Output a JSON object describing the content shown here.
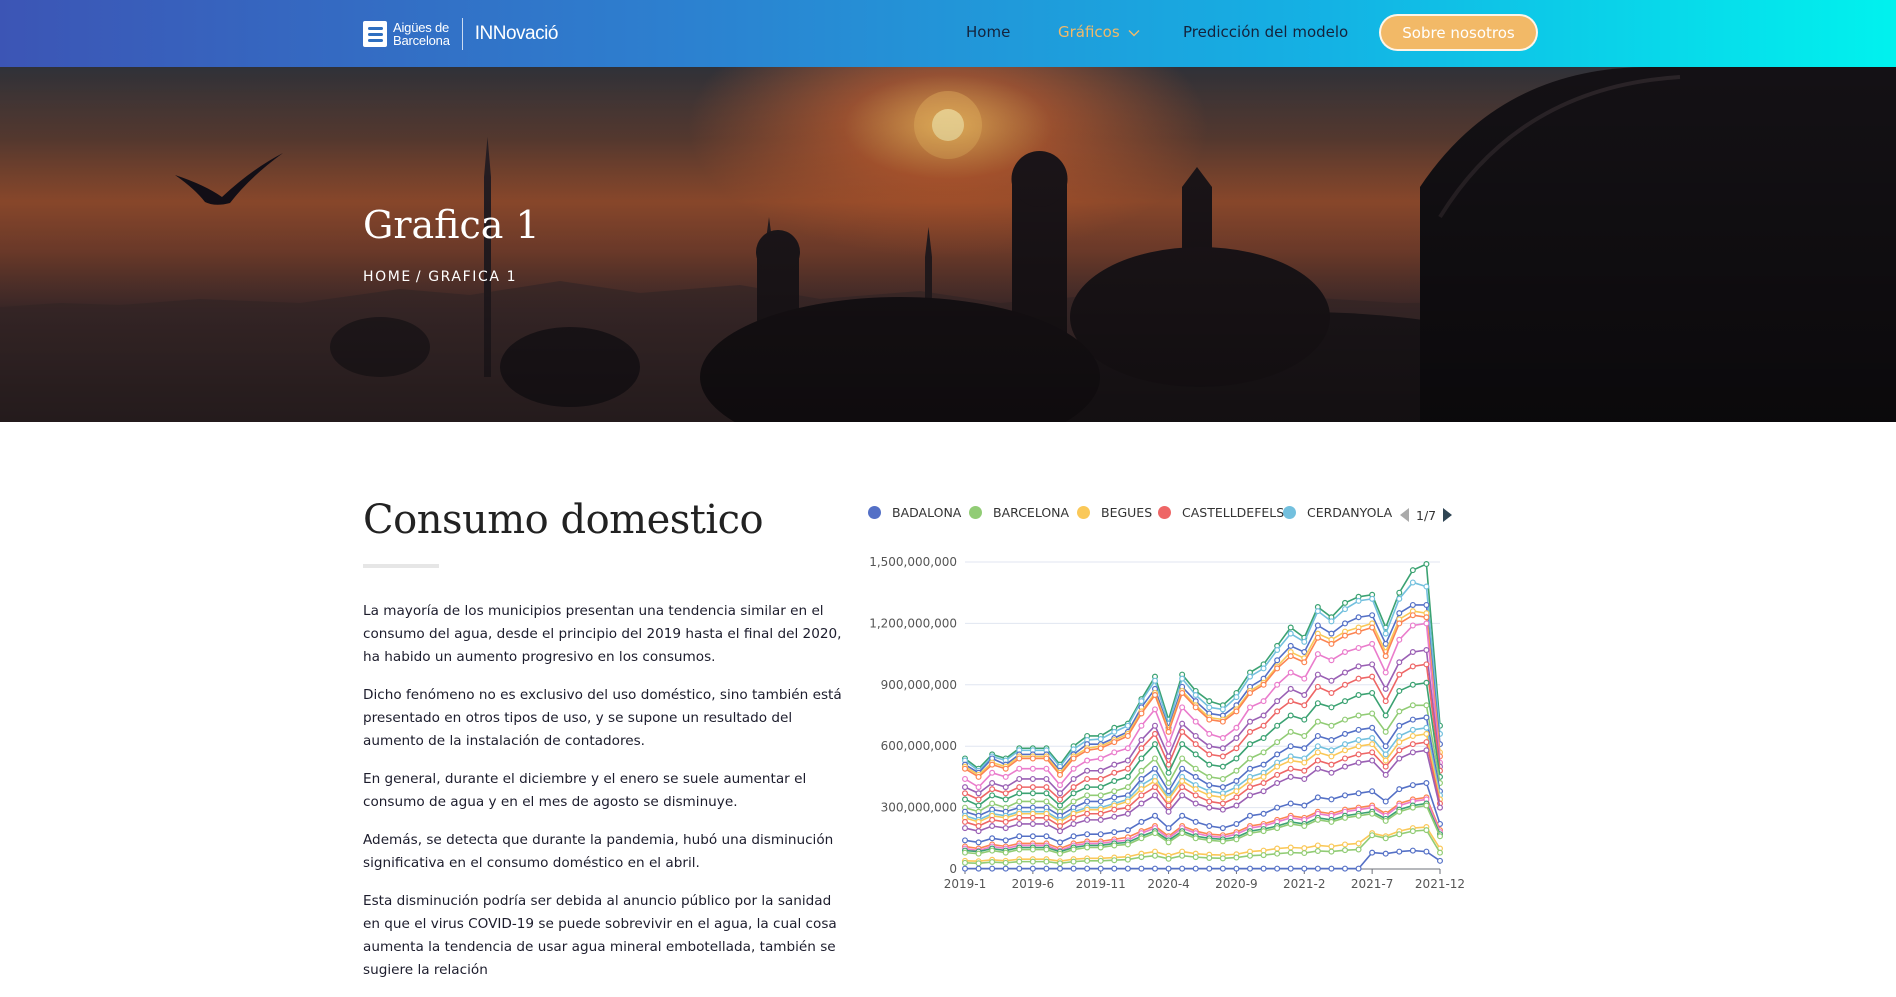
{
  "header": {
    "logo_line1": "Aigües de",
    "logo_line2": "Barcelona",
    "logo_sub": "INNovació",
    "nav": [
      {
        "label": "Home",
        "active": false
      },
      {
        "label": "Gráficos",
        "active": true
      },
      {
        "label": "Predicción del modelo",
        "active": false
      }
    ],
    "cta_label": "Sobre nosotros",
    "colors": {
      "gradient_start": "#3c55b5",
      "gradient_end": "#00f2ee",
      "accent": "#f2b967"
    }
  },
  "hero": {
    "title": "Grafica 1",
    "breadcrumb_home": "HOME",
    "breadcrumb_sep": "/",
    "breadcrumb_current": "GRAFICA 1"
  },
  "content": {
    "section_title": "Consumo domestico",
    "paragraphs": [
      "La mayoría de los municipios presentan una tendencia similar en el consumo del agua, desde el principio del 2019 hasta el final del 2020, ha habido un aumento progresivo en los consumos.",
      "Dicho fenómeno no es exclusivo del uso doméstico, sino también está presentado en otros tipos de uso, y se supone un resultado del aumento de la instalación de contadores.",
      "En general, durante el diciembre y el enero se suele aumentar el consumo de agua y en el mes de agosto se disminuye.",
      "Además, se detecta que durante la pandemia, hubó una disminución significativa en el consumo doméstico en el abril.",
      "Esta disminución podría ser debida al anuncio público por la sanidad en que el virus COVID-19 se puede sobrevivir en el agua, la cual cosa aumenta la tendencia de usar agua mineral embotellada, también se sugiere la relación"
    ]
  },
  "chart_data": {
    "type": "line",
    "legend": {
      "position": "top",
      "visible_entries": [
        {
          "name": "BADALONA",
          "color": "#5470c6"
        },
        {
          "name": "BARCELONA",
          "color": "#91cc75"
        },
        {
          "name": "BEGUES",
          "color": "#fac858"
        },
        {
          "name": "CASTELLDEFELS",
          "color": "#ee6666"
        },
        {
          "name": "CERDANYOLA",
          "color": "#73c0de"
        }
      ],
      "page": "1/7"
    },
    "x_tick_labels": [
      "2019-1",
      "2019-6",
      "2019-11",
      "2020-4",
      "2020-9",
      "2021-2",
      "2021-7",
      "2021-12"
    ],
    "x": [
      "2019-1",
      "2019-2",
      "2019-3",
      "2019-4",
      "2019-5",
      "2019-6",
      "2019-7",
      "2019-8",
      "2019-9",
      "2019-10",
      "2019-11",
      "2019-12",
      "2020-1",
      "2020-2",
      "2020-3",
      "2020-4",
      "2020-5",
      "2020-6",
      "2020-7",
      "2020-8",
      "2020-9",
      "2020-10",
      "2020-11",
      "2020-12",
      "2021-1",
      "2021-2",
      "2021-3",
      "2021-4",
      "2021-5",
      "2021-6",
      "2021-7",
      "2021-8",
      "2021-9",
      "2021-10",
      "2021-11",
      "2021-12"
    ],
    "y_ticks": [
      "0",
      "300,000,000",
      "600,000,000",
      "900,000,000",
      "1,200,000,000",
      "1,500,000,000"
    ],
    "ylim": [
      0,
      1500000000
    ],
    "grid": true,
    "series": [
      {
        "color": "#3ba272",
        "values": [
          540,
          490,
          560,
          540,
          590,
          590,
          590,
          510,
          600,
          650,
          650,
          690,
          710,
          830,
          940,
          730,
          950,
          870,
          820,
          800,
          860,
          960,
          1000,
          1090,
          1180,
          1130,
          1280,
          1230,
          1300,
          1330,
          1340,
          1180,
          1350,
          1460,
          1490,
          700
        ]
      },
      {
        "color": "#73c0de",
        "values": [
          530,
          480,
          550,
          530,
          580,
          580,
          580,
          500,
          585,
          630,
          635,
          670,
          700,
          820,
          920,
          710,
          930,
          850,
          790,
          780,
          840,
          940,
          980,
          1070,
          1150,
          1110,
          1260,
          1210,
          1270,
          1310,
          1320,
          1150,
          1320,
          1400,
          1380,
          660
        ]
      },
      {
        "color": "#5470c6",
        "values": [
          510,
          470,
          540,
          510,
          560,
          560,
          560,
          480,
          560,
          610,
          610,
          640,
          670,
          790,
          880,
          690,
          890,
          820,
          760,
          750,
          800,
          890,
          930,
          1020,
          1090,
          1060,
          1190,
          1150,
          1200,
          1230,
          1240,
          1100,
          1250,
          1290,
          1290,
          610
        ]
      },
      {
        "color": "#fac858",
        "values": [
          500,
          460,
          520,
          500,
          550,
          550,
          550,
          470,
          550,
          590,
          600,
          630,
          660,
          770,
          860,
          680,
          870,
          800,
          740,
          730,
          780,
          870,
          910,
          990,
          1060,
          1030,
          1150,
          1120,
          1160,
          1180,
          1200,
          1060,
          1220,
          1260,
          1250,
          570
        ]
      },
      {
        "color": "#fc8452",
        "values": [
          490,
          450,
          510,
          490,
          540,
          540,
          540,
          460,
          540,
          580,
          590,
          620,
          650,
          760,
          850,
          670,
          860,
          790,
          730,
          720,
          770,
          860,
          900,
          980,
          1040,
          1010,
          1130,
          1100,
          1140,
          1160,
          1180,
          1040,
          1200,
          1240,
          1230,
          550
        ]
      },
      {
        "color": "#ea7ccc",
        "values": [
          440,
          400,
          470,
          450,
          490,
          490,
          490,
          410,
          490,
          530,
          540,
          570,
          590,
          700,
          780,
          610,
          790,
          720,
          660,
          640,
          690,
          790,
          820,
          900,
          960,
          930,
          1050,
          1020,
          1060,
          1080,
          1100,
          960,
          1120,
          1190,
          1200,
          520
        ]
      },
      {
        "color": "#9a60b4",
        "values": [
          400,
          370,
          420,
          400,
          440,
          440,
          440,
          370,
          440,
          480,
          480,
          510,
          530,
          630,
          700,
          550,
          710,
          650,
          600,
          590,
          640,
          720,
          750,
          820,
          880,
          850,
          950,
          920,
          960,
          990,
          1000,
          880,
          1010,
          1060,
          1070,
          500
        ]
      },
      {
        "color": "#ee6666",
        "values": [
          370,
          340,
          390,
          370,
          400,
          400,
          400,
          340,
          400,
          440,
          440,
          470,
          490,
          590,
          660,
          510,
          670,
          610,
          560,
          550,
          590,
          670,
          700,
          770,
          820,
          800,
          890,
          860,
          900,
          930,
          940,
          820,
          950,
          990,
          1000,
          480
        ]
      },
      {
        "color": "#3ba272",
        "values": [
          340,
          310,
          360,
          340,
          370,
          370,
          370,
          310,
          370,
          400,
          400,
          430,
          450,
          540,
          610,
          470,
          610,
          560,
          510,
          500,
          540,
          610,
          640,
          700,
          750,
          730,
          810,
          790,
          820,
          850,
          860,
          750,
          870,
          900,
          910,
          450
        ]
      },
      {
        "color": "#91cc75",
        "values": [
          300,
          280,
          320,
          300,
          330,
          330,
          330,
          280,
          330,
          360,
          360,
          380,
          400,
          480,
          540,
          420,
          540,
          490,
          450,
          440,
          480,
          540,
          570,
          620,
          670,
          650,
          720,
          700,
          730,
          750,
          760,
          670,
          770,
          800,
          800,
          420
        ]
      },
      {
        "color": "#5470c6",
        "values": [
          280,
          260,
          290,
          280,
          300,
          300,
          300,
          260,
          300,
          330,
          330,
          350,
          360,
          440,
          490,
          380,
          490,
          450,
          410,
          400,
          430,
          490,
          510,
          560,
          600,
          590,
          650,
          630,
          660,
          680,
          690,
          600,
          700,
          730,
          740,
          380
        ]
      },
      {
        "color": "#73c0de",
        "values": [
          260,
          240,
          270,
          260,
          280,
          280,
          280,
          240,
          280,
          300,
          300,
          320,
          340,
          410,
          450,
          350,
          450,
          410,
          380,
          370,
          400,
          450,
          470,
          520,
          550,
          540,
          600,
          580,
          610,
          630,
          640,
          560,
          650,
          680,
          690,
          360
        ]
      },
      {
        "color": "#fac858",
        "values": [
          250,
          230,
          260,
          250,
          270,
          270,
          270,
          230,
          270,
          290,
          290,
          310,
          330,
          390,
          430,
          340,
          430,
          390,
          360,
          350,
          380,
          430,
          450,
          500,
          530,
          520,
          570,
          550,
          580,
          600,
          610,
          530,
          620,
          650,
          660,
          340
        ]
      },
      {
        "color": "#ee6666",
        "values": [
          230,
          210,
          240,
          230,
          250,
          250,
          250,
          210,
          250,
          270,
          270,
          290,
          300,
          360,
          400,
          310,
          400,
          360,
          330,
          320,
          350,
          400,
          420,
          460,
          490,
          480,
          530,
          510,
          540,
          560,
          570,
          500,
          580,
          610,
          620,
          320
        ]
      },
      {
        "color": "#9a60b4",
        "values": [
          200,
          185,
          210,
          200,
          220,
          220,
          220,
          185,
          220,
          240,
          240,
          255,
          270,
          320,
          360,
          280,
          360,
          320,
          300,
          290,
          310,
          360,
          380,
          420,
          450,
          440,
          490,
          470,
          500,
          520,
          530,
          460,
          540,
          570,
          580,
          300
        ]
      },
      {
        "color": "#5470c6",
        "values": [
          140,
          130,
          150,
          140,
          160,
          160,
          160,
          130,
          160,
          170,
          170,
          180,
          190,
          230,
          260,
          200,
          260,
          230,
          210,
          200,
          220,
          260,
          270,
          300,
          320,
          310,
          350,
          340,
          360,
          370,
          380,
          330,
          390,
          410,
          420,
          220
        ]
      },
      {
        "color": "#fc8452",
        "values": [
          110,
          100,
          120,
          110,
          125,
          125,
          125,
          100,
          125,
          135,
          135,
          145,
          155,
          185,
          210,
          160,
          210,
          185,
          170,
          165,
          180,
          210,
          220,
          240,
          260,
          250,
          280,
          270,
          290,
          300,
          310,
          270,
          320,
          340,
          350,
          190
        ]
      },
      {
        "color": "#ea7ccc",
        "values": [
          100,
          90,
          110,
          100,
          115,
          115,
          115,
          90,
          115,
          125,
          125,
          135,
          140,
          175,
          200,
          150,
          200,
          175,
          160,
          155,
          170,
          200,
          210,
          230,
          250,
          240,
          270,
          260,
          280,
          290,
          300,
          260,
          310,
          330,
          340,
          180
        ]
      },
      {
        "color": "#3ba272",
        "values": [
          90,
          85,
          100,
          90,
          105,
          105,
          105,
          85,
          105,
          115,
          115,
          125,
          130,
          160,
          185,
          140,
          185,
          160,
          150,
          145,
          155,
          185,
          195,
          210,
          230,
          220,
          250,
          240,
          260,
          270,
          280,
          245,
          290,
          310,
          320,
          170
        ]
      },
      {
        "color": "#91cc75",
        "values": [
          80,
          75,
          90,
          80,
          95,
          95,
          95,
          75,
          95,
          105,
          105,
          115,
          120,
          150,
          175,
          130,
          175,
          150,
          140,
          135,
          145,
          175,
          185,
          200,
          220,
          210,
          240,
          230,
          250,
          260,
          270,
          235,
          280,
          300,
          310,
          160
        ]
      },
      {
        "color": "#fac858",
        "values": [
          40,
          38,
          45,
          40,
          48,
          48,
          48,
          38,
          48,
          52,
          52,
          56,
          60,
          75,
          85,
          65,
          85,
          75,
          70,
          68,
          72,
          85,
          90,
          100,
          105,
          102,
          115,
          110,
          120,
          125,
          175,
          160,
          185,
          200,
          205,
          100
        ]
      },
      {
        "color": "#91cc75",
        "values": [
          30,
          28,
          34,
          30,
          36,
          36,
          36,
          28,
          36,
          40,
          40,
          43,
          46,
          58,
          65,
          50,
          65,
          58,
          54,
          52,
          56,
          65,
          68,
          75,
          80,
          78,
          88,
          85,
          92,
          95,
          165,
          150,
          170,
          185,
          190,
          80
        ]
      },
      {
        "color": "#5470c6",
        "values": [
          2,
          2,
          2,
          2,
          2,
          2,
          2,
          2,
          2,
          2,
          2,
          2,
          2,
          2,
          2,
          2,
          2,
          2,
          2,
          2,
          2,
          2,
          2,
          2,
          2,
          2,
          2,
          2,
          2,
          2,
          80,
          75,
          85,
          90,
          85,
          40
        ]
      }
    ],
    "value_unit_multiplier": 1000000
  }
}
